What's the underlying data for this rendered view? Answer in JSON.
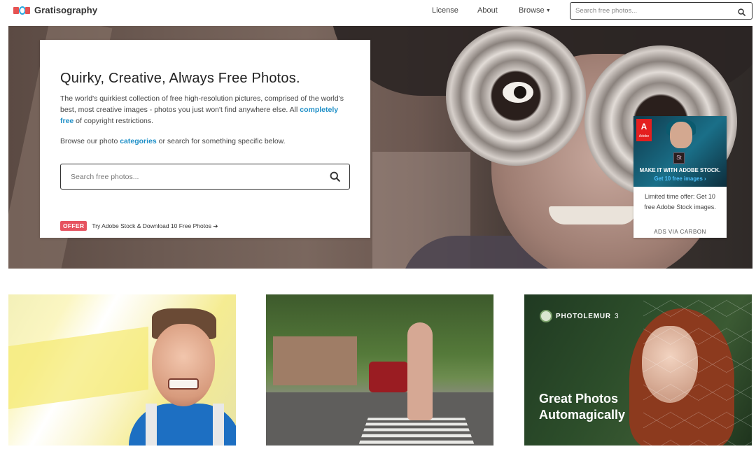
{
  "header": {
    "brand": "Gratisography",
    "nav": [
      "License",
      "About",
      "Browse"
    ],
    "search_placeholder": "Search free photos..."
  },
  "hero": {
    "title": "Quirky, Creative, Always Free Photos.",
    "desc_before": "The world's quirkiest collection of free high-resolution pictures, comprised of the world's best, most creative images - photos you just won't find anywhere else. All ",
    "desc_link": "completely free",
    "desc_after": " of copyright restrictions.",
    "browse_before": "Browse our photo ",
    "browse_link": "categories",
    "browse_after": " or search for something specific below.",
    "search_placeholder": "Search free photos...",
    "offer_badge": "OFFER",
    "offer_text": "Try Adobe Stock & Download 10 Free Photos"
  },
  "ad": {
    "logo": "A",
    "logo_sub": "Adobe",
    "st": "St",
    "headline": "MAKE IT WITH ADOBE STOCK.",
    "cta": "Get 10 free images ›",
    "description": "Limited time offer: Get 10 free Adobe Stock images.",
    "via": "ADS VIA CARBON"
  },
  "thumbs": {
    "third": {
      "brand": "PHOTOLEMUR",
      "version": "3",
      "tagline": "Great Photos Automagically"
    }
  },
  "colors": {
    "link": "#1e8fc7",
    "offer_badge": "#e6525f",
    "ad_cta": "#4fc3ff"
  },
  "icons": [
    "logo-icon",
    "search-icon",
    "chevron-down-icon",
    "arrow-right-icon"
  ]
}
